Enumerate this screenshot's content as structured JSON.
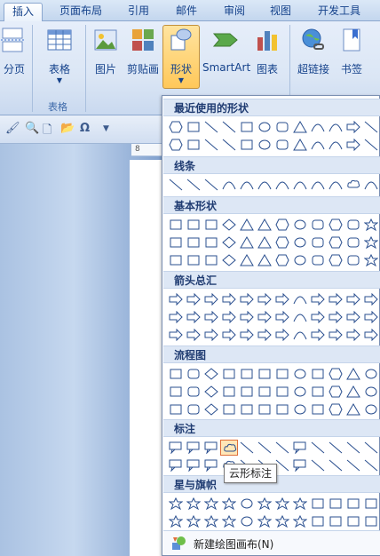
{
  "tabs": [
    "插入",
    "页面布局",
    "引用",
    "邮件",
    "审阅",
    "视图",
    "开发工具"
  ],
  "ribbon": {
    "page_break": "分页",
    "table": "表格",
    "table_group": "表格",
    "picture": "图片",
    "clipart": "剪贴画",
    "shapes": "形状",
    "smartart": "SmartArt",
    "chart": "图表",
    "hyperlink": "超链接",
    "bookmark": "书签"
  },
  "ruler_mark": "8",
  "dropdown": {
    "sections": [
      "最近使用的形状",
      "线条",
      "基本形状",
      "箭头总汇",
      "流程图",
      "标注",
      "星与旗帜"
    ],
    "new_canvas": "新建绘图画布(N)",
    "tooltip": "云形标注"
  },
  "colors": {
    "accent": "#15428b",
    "highlight": "#ffc85a"
  }
}
